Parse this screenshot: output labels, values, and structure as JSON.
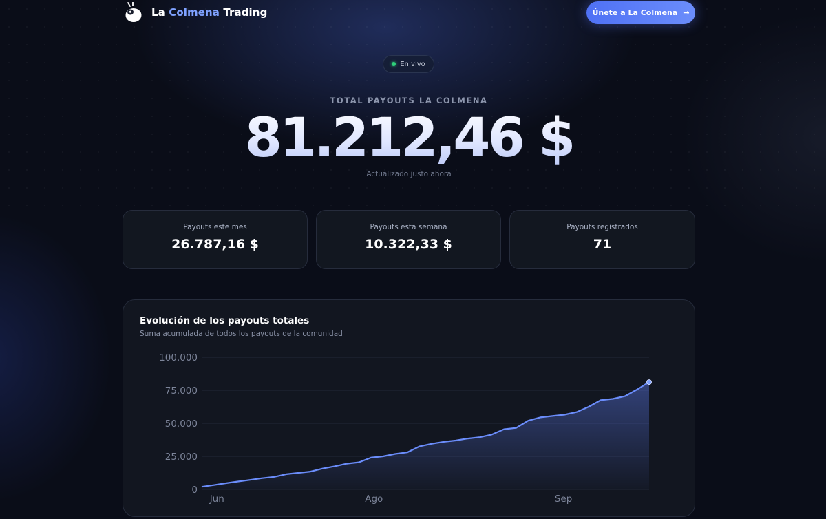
{
  "header": {
    "brand_prefix": "La",
    "brand_accent": "Colmena",
    "brand_suffix": "Trading",
    "cta_label": "Únete a La Colmena",
    "cta_icon": "arrow-right-icon"
  },
  "live_badge": {
    "label": "En vivo",
    "status_color": "#2fd07a"
  },
  "hero": {
    "label": "TOTAL PAYOUTS LA COLMENA",
    "value": "81.212,46 $",
    "updated": "Actualizado justo ahora"
  },
  "stats": [
    {
      "label": "Payouts este mes",
      "value": "26.787,16 $"
    },
    {
      "label": "Payouts esta semana",
      "value": "10.322,33 $"
    },
    {
      "label": "Payouts registrados",
      "value": "71"
    }
  ],
  "chart_card": {
    "title": "Evolución de los payouts totales",
    "subtitle": "Suma acumulada de todos los payouts de la comunidad"
  },
  "colors": {
    "accent": "#6b8dfb",
    "background": "#0a0d18",
    "card": "#121620"
  },
  "chart_data": {
    "type": "area",
    "title": "Evolución de los payouts totales",
    "xlabel": "",
    "ylabel": "",
    "ylim": [
      0,
      100000
    ],
    "y_ticks": [
      "0",
      "25.000",
      "50.000",
      "75.000",
      "100.000"
    ],
    "x_ticks": [
      "Jun",
      "Ago",
      "Sep"
    ],
    "grid": true,
    "series": [
      {
        "values": [
          2000,
          3300,
          4700,
          6000,
          7200,
          8500,
          9500,
          11500,
          12500,
          13500,
          15800,
          17500,
          19500,
          20500,
          24000,
          25000,
          26800,
          28000,
          32500,
          34500,
          36000,
          37000,
          38500,
          39500,
          41500,
          45500,
          46500,
          52000,
          54500,
          55500,
          56500,
          58500,
          62500,
          67500,
          68500,
          70500,
          75500,
          81212
        ]
      }
    ]
  }
}
